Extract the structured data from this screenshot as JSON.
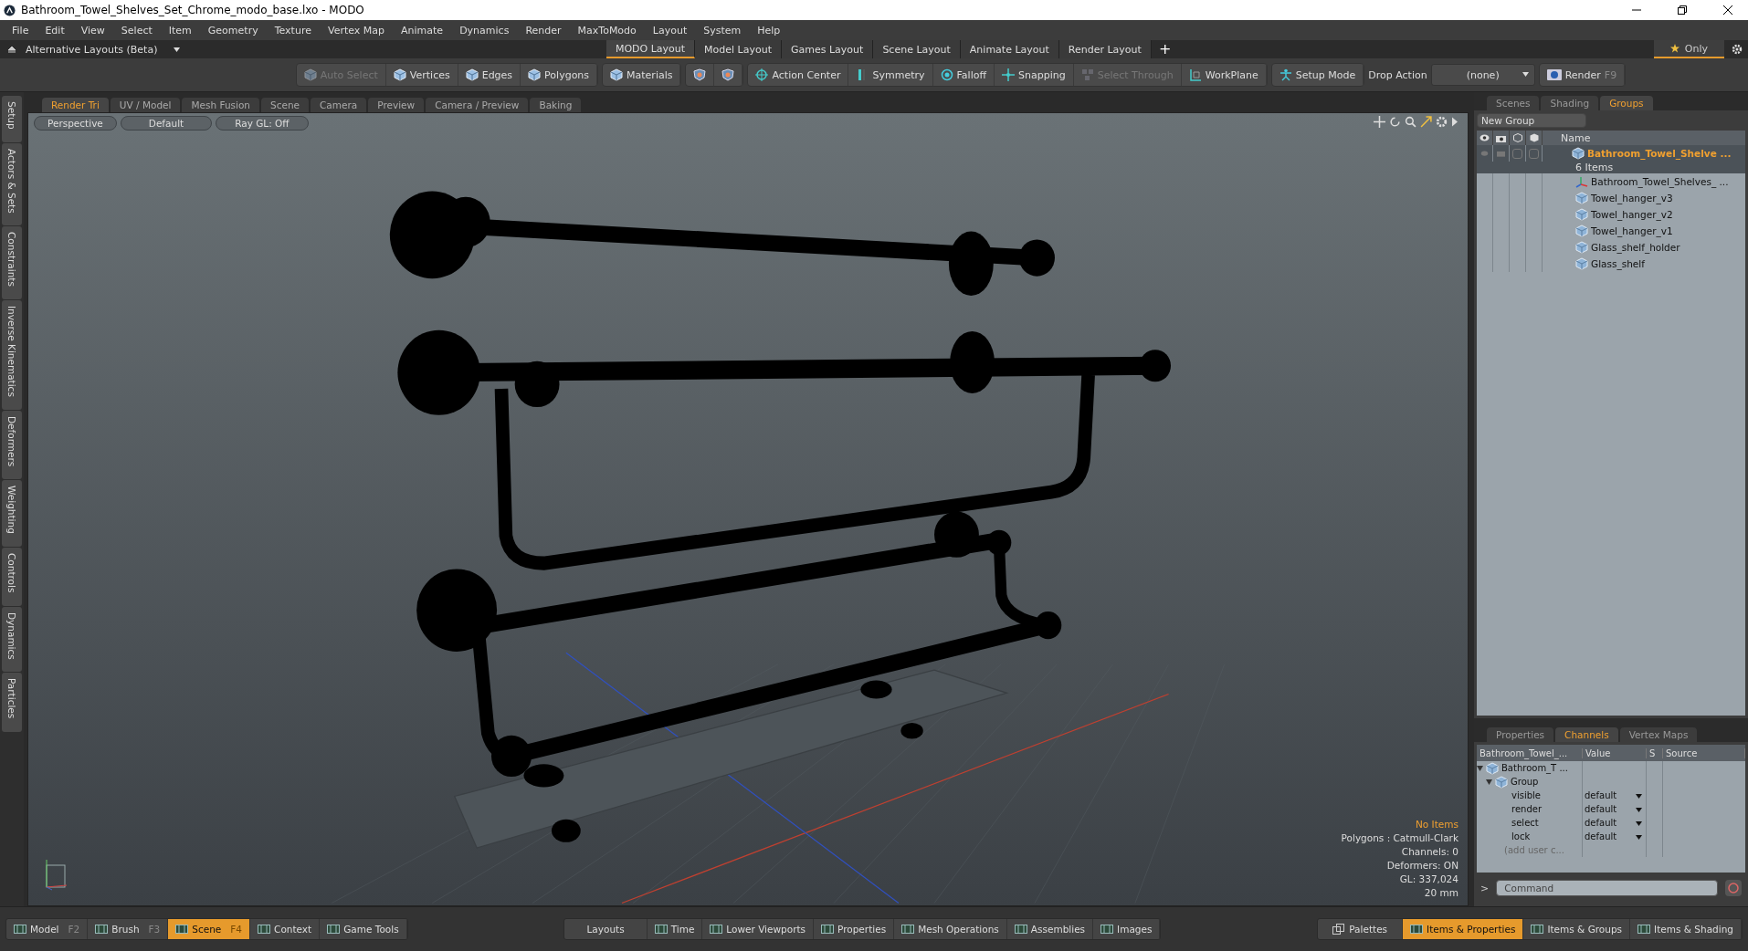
{
  "window": {
    "title": "Bathroom_Towel_Shelves_Set_Chrome_modo_base.lxo - MODO"
  },
  "menu": [
    "File",
    "Edit",
    "View",
    "Select",
    "Item",
    "Geometry",
    "Texture",
    "Vertex Map",
    "Animate",
    "Dynamics",
    "Render",
    "MaxToModo",
    "Layout",
    "System",
    "Help"
  ],
  "layout_bar": {
    "menu_label": "Alternative Layouts (Beta)",
    "tabs": [
      {
        "label": "MODO Layout",
        "selected": true
      },
      {
        "label": "Model Layout",
        "selected": false
      },
      {
        "label": "Games Layout",
        "selected": false
      },
      {
        "label": "Scene Layout",
        "selected": false
      },
      {
        "label": "Animate Layout",
        "selected": false
      },
      {
        "label": "Render Layout",
        "selected": false
      }
    ],
    "add": "+",
    "only_label": "Only"
  },
  "toolbar": {
    "groups": [
      [
        {
          "label": "Auto Select",
          "kind": "cube",
          "disabled": true
        },
        {
          "label": "Vertices",
          "kind": "cube",
          "disabled": false
        },
        {
          "label": "Edges",
          "kind": "cube",
          "disabled": false
        },
        {
          "label": "Polygons",
          "kind": "cube",
          "disabled": false
        }
      ],
      [
        {
          "label": "Materials",
          "kind": "cube",
          "disabled": false
        }
      ],
      [
        {
          "kind": "shield",
          "disabled": false
        },
        {
          "kind": "shield",
          "disabled": false
        }
      ],
      [
        {
          "label": "Action Center",
          "kind": "crosshair",
          "disabled": false
        },
        {
          "label": "Symmetry",
          "kind": "bar",
          "disabled": false
        },
        {
          "label": "Falloff",
          "kind": "ring",
          "disabled": false
        },
        {
          "label": "Snapping",
          "kind": "snap",
          "disabled": false
        },
        {
          "label": "Select Through",
          "kind": "cubes",
          "disabled": true
        },
        {
          "label": "WorkPlane",
          "kind": "grid",
          "disabled": false
        }
      ],
      [
        {
          "label": "Setup Mode",
          "kind": "figure",
          "disabled": false
        }
      ]
    ],
    "drop_action_label": "Drop Action",
    "drop_action_value": "(none)",
    "render_label": "Render",
    "render_key": "F9"
  },
  "left_tabs": [
    "Setup",
    "Actors & Sets",
    "Constraints",
    "Inverse Kinematics",
    "Deformers",
    "Weighting",
    "Controls",
    "Dynamics",
    "Particles"
  ],
  "viewport_tabs": [
    {
      "label": "Render Tri",
      "selected": true
    },
    {
      "label": "UV / Model",
      "selected": false
    },
    {
      "label": "Mesh Fusion",
      "selected": false
    },
    {
      "label": "Scene",
      "selected": false
    },
    {
      "label": "Camera",
      "selected": false
    },
    {
      "label": "Preview",
      "selected": false
    },
    {
      "label": "Camera / Preview",
      "selected": false
    },
    {
      "label": "Baking",
      "selected": false
    }
  ],
  "viewport": {
    "view": "Perspective",
    "style": "Default",
    "raygl": "Ray GL: Off",
    "stats_title": "No Items",
    "stats": [
      "Polygons : Catmull-Clark",
      "Channels: 0",
      "Deformers: ON",
      "GL: 337,024",
      "20 mm"
    ]
  },
  "groups_panel": {
    "tabs": [
      {
        "label": "Scenes",
        "selected": false
      },
      {
        "label": "Shading",
        "selected": false
      },
      {
        "label": "Groups",
        "selected": true
      }
    ],
    "new_group": "New Group",
    "name_column": "Name",
    "root": {
      "name": "Bathroom_Towel_Shelve ...",
      "count": "6 Items",
      "selected": true,
      "children": [
        {
          "name": "Bathroom_Towel_Shelves_ ...",
          "kind": "locator",
          "selected": false
        },
        {
          "name": "Towel_hanger_v3",
          "kind": "mesh",
          "selected": false
        },
        {
          "name": "Towel_hanger_v2",
          "kind": "mesh",
          "selected": false
        },
        {
          "name": "Towel_hanger_v1",
          "kind": "mesh",
          "selected": false
        },
        {
          "name": "Glass_shelf_holder",
          "kind": "mesh",
          "selected": false
        },
        {
          "name": "Glass_shelf",
          "kind": "mesh",
          "selected": false
        }
      ]
    }
  },
  "channels_panel": {
    "tabs": [
      {
        "label": "Properties",
        "selected": false
      },
      {
        "label": "Channels",
        "selected": true
      },
      {
        "label": "Vertex Maps",
        "selected": false
      }
    ],
    "columns": [
      "Bathroom_Towel_...",
      "Value",
      "S",
      "Source"
    ],
    "item": {
      "name": "Bathroom_T ...",
      "expanded": true,
      "group": {
        "name": "Group",
        "expanded": true,
        "channels": [
          {
            "name": "visible",
            "value": "default"
          },
          {
            "name": "render",
            "value": "default"
          },
          {
            "name": "select",
            "value": "default"
          },
          {
            "name": "lock",
            "value": "default"
          }
        ],
        "add_label": "(add user c..."
      }
    }
  },
  "command": {
    "prompt": ">",
    "placeholder": "Command"
  },
  "bottom_bar": {
    "left": [
      {
        "label": "Model",
        "key": "F2",
        "selected": false
      },
      {
        "label": "Brush",
        "key": "F3",
        "selected": false
      },
      {
        "label": "Scene",
        "key": "F4",
        "selected": true
      },
      {
        "label": "Context",
        "selected": false
      },
      {
        "label": "Game Tools",
        "selected": false
      }
    ],
    "center": [
      {
        "label": "Layouts",
        "kind": "plain",
        "selected": false
      },
      {
        "label": "Time",
        "kind": "panel",
        "selected": false
      },
      {
        "label": "Lower Viewports",
        "kind": "panel",
        "selected": false
      },
      {
        "label": "Properties",
        "kind": "panel",
        "selected": false
      },
      {
        "label": "Mesh Operations",
        "kind": "panel",
        "selected": false
      },
      {
        "label": "Assemblies",
        "kind": "panel",
        "selected": false
      },
      {
        "label": "Images",
        "kind": "panel",
        "selected": false
      }
    ],
    "right": [
      {
        "label": "Palettes",
        "kind": "palette",
        "selected": false
      },
      {
        "label": "Items & Properties",
        "kind": "panel",
        "selected": true
      },
      {
        "label": "Items & Groups",
        "kind": "panel",
        "selected": false
      },
      {
        "label": "Items & Shading",
        "kind": "panel",
        "selected": false
      }
    ]
  }
}
